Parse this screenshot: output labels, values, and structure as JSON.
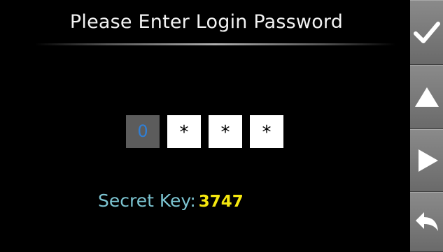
{
  "header": {
    "title": "Please Enter Login Password"
  },
  "password": {
    "digits": [
      {
        "char": "0",
        "state": "active"
      },
      {
        "char": "*",
        "state": "masked"
      },
      {
        "char": "*",
        "state": "masked"
      },
      {
        "char": "*",
        "state": "masked"
      }
    ]
  },
  "secret_key": {
    "label": "Secret Key:",
    "value": "3747"
  },
  "sidebar": {
    "buttons": [
      {
        "icon": "checkmark-icon"
      },
      {
        "icon": "arrow-up-icon"
      },
      {
        "icon": "arrow-right-icon"
      },
      {
        "icon": "back-arrow-icon"
      }
    ]
  },
  "colors": {
    "background": "#000000",
    "active_digit_bg": "#5c5c5c",
    "active_digit_text": "#2f7fd6",
    "secret_label": "#7cc4d1",
    "secret_value": "#f5e70f",
    "sidebar": "#7a7a7a"
  }
}
